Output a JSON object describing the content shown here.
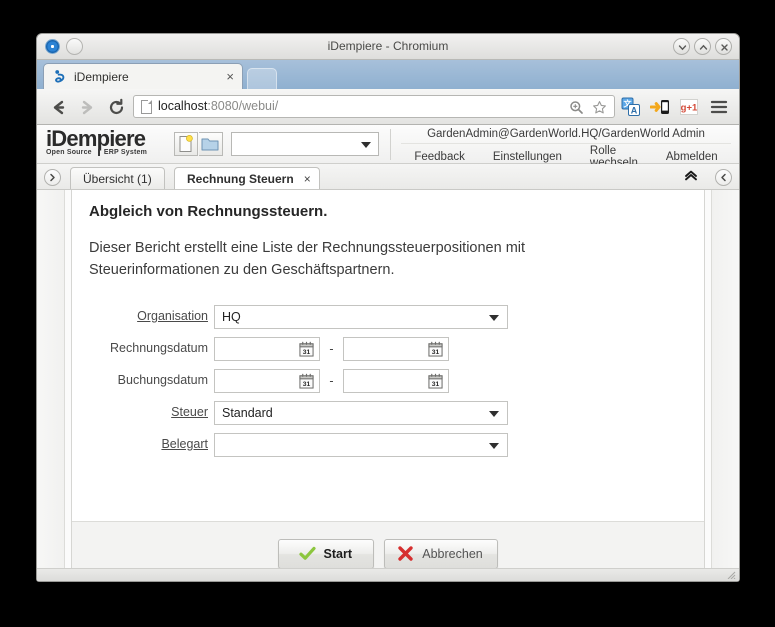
{
  "window": {
    "title": "iDempiere - Chromium",
    "controls": {
      "minimize": "minimize-icon",
      "maximize": "maximize-icon",
      "close": "close-icon"
    }
  },
  "browser": {
    "tab": {
      "title": "iDempiere",
      "close_label": "×"
    },
    "new_tab_label": "",
    "nav": {
      "back": "←",
      "forward": "→",
      "reload": "⟳"
    },
    "url": {
      "host": "localhost",
      "rest": ":8080/webui/",
      "full": "localhost:8080/webui/"
    },
    "extensions": [
      {
        "name": "translate-extension-icon",
        "glyph": "文A"
      },
      {
        "name": "mobile-extension-icon",
        "glyph": "➡"
      },
      {
        "name": "gplus-extension-icon",
        "glyph": "g+1"
      }
    ],
    "menu_label": "☰"
  },
  "app": {
    "logo": {
      "main": "iDempiere",
      "sub_left": "Open Source",
      "sub_right": "ERP System"
    },
    "header_buttons": [
      {
        "name": "new-record-button",
        "label": ""
      },
      {
        "name": "open-folder-button",
        "label": ""
      }
    ],
    "search": {
      "value": "",
      "placeholder": ""
    },
    "user": "GardenAdmin@GardenWorld.HQ/GardenWorld Admin",
    "links": [
      "Feedback",
      "Einstellungen",
      "Rolle wechseln",
      "Abmelden"
    ],
    "tabs": [
      {
        "label": "Übersicht (1)",
        "active": false,
        "closable": false
      },
      {
        "label": "Rechnung Steuern",
        "active": true,
        "closable": true,
        "close_label": "×"
      }
    ],
    "collapse_label": "ⱏ",
    "side_toggle_left": "›",
    "side_toggle_right": "‹"
  },
  "report": {
    "title": "Abgleich von Rechnungssteuern.",
    "description": "Dieser Bericht erstellt eine Liste der Rechnungssteuerpositionen mit Steuerinformationen zu den Geschäftspartnern.",
    "fields": [
      {
        "label": "Organisation",
        "type": "combo",
        "value": "HQ",
        "mandatory": true
      },
      {
        "label": "Rechnungsdatum",
        "type": "daterange",
        "from": "",
        "to": "",
        "separator": "-",
        "mandatory": false
      },
      {
        "label": "Buchungsdatum",
        "type": "daterange",
        "from": "",
        "to": "",
        "separator": "-",
        "mandatory": false
      },
      {
        "label": "Steuer",
        "type": "combo",
        "value": "Standard",
        "mandatory": true
      },
      {
        "label": "Belegart",
        "type": "combo",
        "value": "",
        "mandatory": true
      }
    ],
    "buttons": {
      "start": {
        "label": "Start",
        "icon": "check-icon",
        "color": "#8cc63e"
      },
      "cancel": {
        "label": "Abbrechen",
        "icon": "x-icon",
        "color": "#d62f2f"
      }
    }
  }
}
